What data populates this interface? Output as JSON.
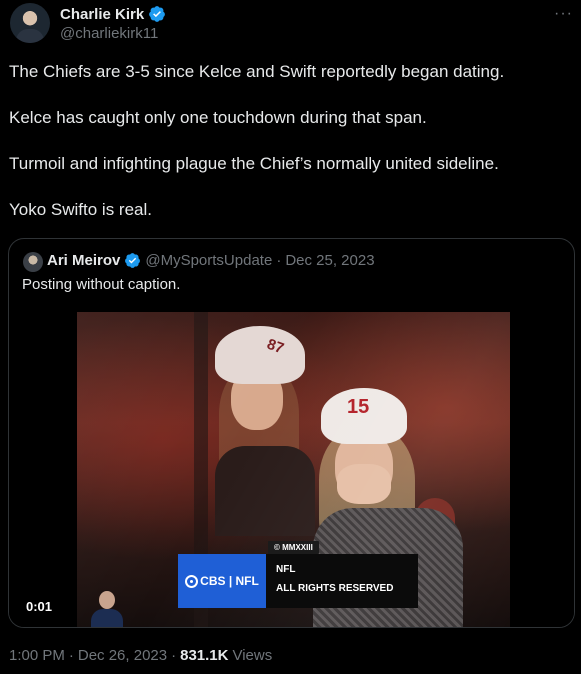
{
  "author": {
    "name": "Charlie Kirk",
    "handle": "@charliekirk11",
    "verified_color": "#1d9bf0"
  },
  "more_icon": "more-dots-icon",
  "tweet": {
    "paragraphs": [
      "The Chiefs are 3-5 since Kelce and Swift reportedly began dating.",
      "Kelce has caught only one touchdown during that span.",
      "Turmoil and infighting plague the Chief’s normally united sideline.",
      "Yoko Swifto is real."
    ]
  },
  "quote": {
    "name": "Ari Meirov",
    "handle": "@MySportsUpdate",
    "separator": "·",
    "date": "Dec 25, 2023",
    "text": "Posting without caption.",
    "video": {
      "duration": "0:01",
      "overlay": {
        "copyright": "© MMXXIII",
        "network": "CBS | NFL",
        "line1": "NFL",
        "line2": "ALL RIGHTS RESERVED"
      },
      "hat_number": "15",
      "hat_letters": "87"
    }
  },
  "meta": {
    "time": "1:00 PM",
    "sep1": "·",
    "date": "Dec 26, 2023",
    "sep2": "·",
    "views_count": "831.1K",
    "views_label": "Views"
  },
  "colors": {
    "background": "#000000",
    "text": "#e7e9ea",
    "muted": "#71767b",
    "border": "#2f3336",
    "cbs_blue": "#1f5fd6"
  }
}
